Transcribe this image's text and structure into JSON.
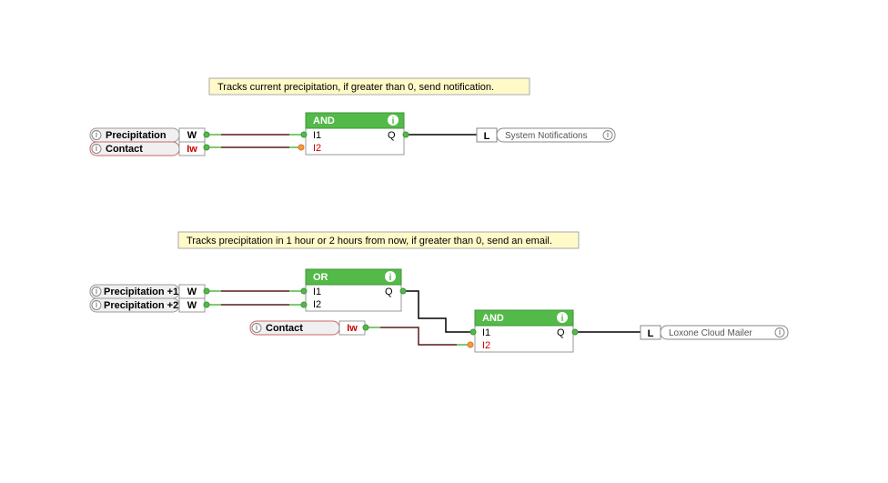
{
  "descriptions": {
    "top": "Tracks current precipitation, if greater than 0, send notification.",
    "bottom": "Tracks precipitation in 1 hour or 2 hours from now, if greater than 0, send an email."
  },
  "inputs": {
    "precipitation": {
      "label": "Precipitation",
      "pin": "W"
    },
    "contact": {
      "label": "Contact",
      "pin": "Iw"
    },
    "precipitation1": {
      "label": "Precipitation +1",
      "pin": "W"
    },
    "precipitation2": {
      "label": "Precipitation +2",
      "pin": "W"
    },
    "contact2": {
      "label": "Contact",
      "pin": "Iw"
    }
  },
  "gates": {
    "and1": {
      "title": "AND",
      "i1": "I1",
      "i2": "I2",
      "q": "Q"
    },
    "or1": {
      "title": "OR",
      "i1": "I1",
      "i2": "I2",
      "q": "Q"
    },
    "and2": {
      "title": "AND",
      "i1": "I1",
      "i2": "I2",
      "q": "Q"
    }
  },
  "outputs": {
    "notif": {
      "L": "L",
      "label": "System Notifications"
    },
    "mailer": {
      "L": "L",
      "label": "Loxone Cloud Mailer"
    }
  }
}
